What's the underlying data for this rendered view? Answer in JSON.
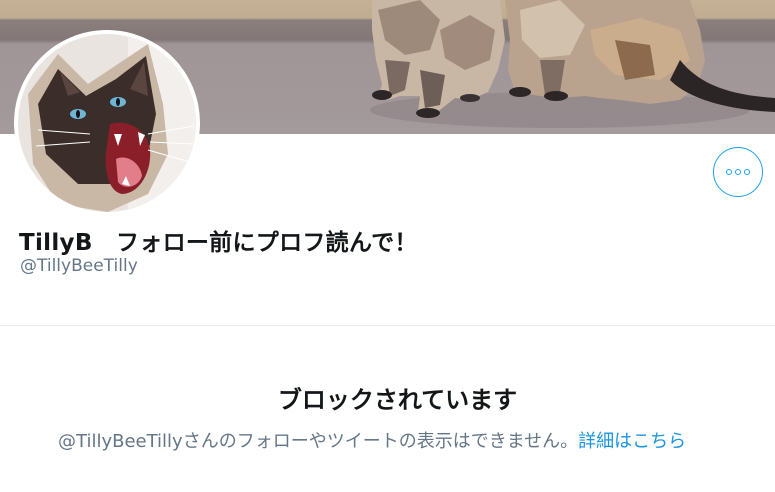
{
  "profile": {
    "display_name": "TillyB　フォロー前にプロフ読んで！",
    "handle": "@TillyBeeTilly"
  },
  "blocked": {
    "title": "ブロックされています",
    "description": "@TillyBeeTillyさんのフォローやツイートの表示はできません。",
    "link_label": "詳細はこちら"
  },
  "icons": {
    "more": "more-horizontal-icon"
  },
  "colors": {
    "accent": "#1da1f2",
    "text_primary": "#14171a",
    "text_secondary": "#657786",
    "link": "#1b95e0"
  }
}
